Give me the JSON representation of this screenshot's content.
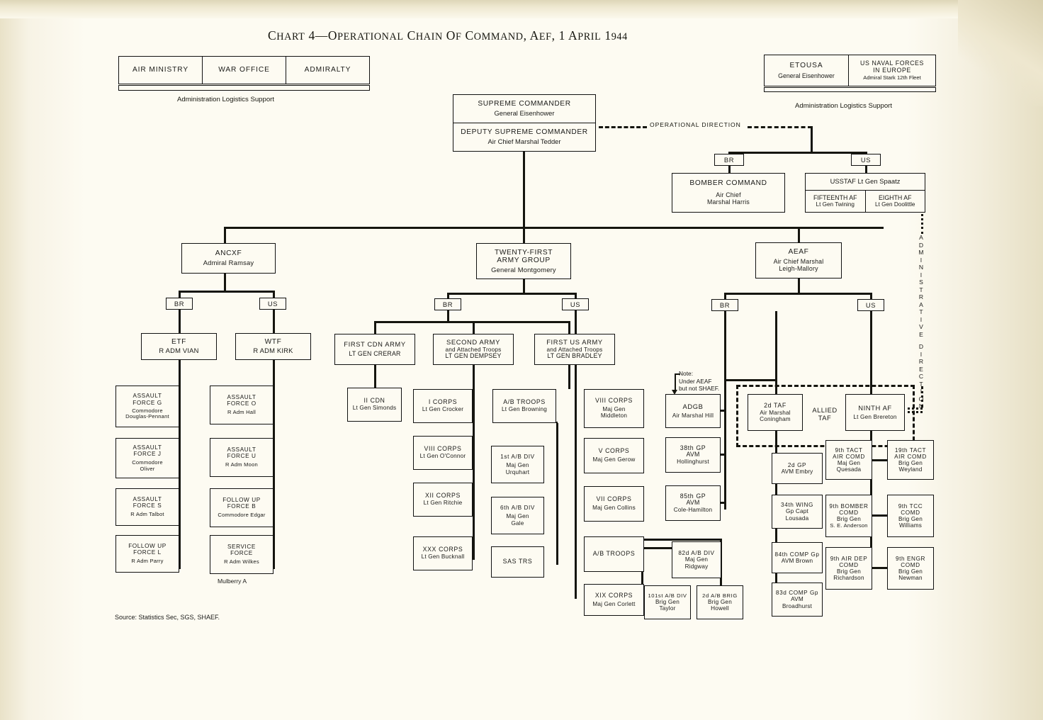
{
  "chart": {
    "title_prefix": "Chart 4",
    "title_dash": "—",
    "title_main": "Operational Chain of Command, AEF, 1 April 1944",
    "title_full": "Chart 4—Operational Chain of Command, AEF, 1 April 1944",
    "source_note": "Source: Statistics Sec, SGS, SHAEF.",
    "operational_direction_label": "OPERATIONAL DIRECTION",
    "administrative_direction_label": "ADMINISTRATIVE DIRECTION",
    "admin_left_caption": "Administration Logistics Support",
    "admin_right_caption": "Administration Logistics Support",
    "mulberry_caption": "Mulberry A",
    "aeaf_note": "Note:\nUnder AEAF\nbut not SHAEF.",
    "allied_taf_label_line1": "ALLIED",
    "allied_taf_label_line2": "TAF"
  },
  "tags": {
    "br": "BR",
    "us": "US"
  },
  "british_ministries": {
    "items": [
      {
        "label": "AIR MINISTRY"
      },
      {
        "label": "WAR OFFICE"
      },
      {
        "label": "ADMIRALTY"
      }
    ]
  },
  "us_theater": {
    "items": [
      {
        "title": "ETOUSA",
        "commander": "General  Eisenhower"
      },
      {
        "title_line1": "US NAVAL FORCES",
        "title_line2": "IN EUROPE",
        "commander": "Admiral Stark 12th Fleet"
      }
    ]
  },
  "supreme": {
    "commander_title": "SUPREME COMMANDER",
    "commander_name": "General  Eisenhower",
    "deputy_title": "DEPUTY SUPREME COMMANDER",
    "deputy_name": "Air Chief Marshal Tedder"
  },
  "strategic_air": {
    "bomber_command": {
      "title": "BOMBER COMMAND",
      "line1": "Air Chief",
      "line2": "Marshal Harris"
    },
    "usstaf": {
      "title": "USSTAF   Lt Gen Spaatz",
      "sub": [
        {
          "name": "FIFTEENTH AF",
          "commander": "Lt Gen Twining"
        },
        {
          "name": "EIGHTH AF",
          "commander": "Lt Gen Doolittle"
        }
      ]
    }
  },
  "ancxf": {
    "title": "ANCXF",
    "commander": "Admiral Ramsay",
    "br": {
      "force": {
        "title": "ETF",
        "commander": "R ADM VIAN"
      },
      "children": [
        {
          "line1": "ASSAULT",
          "line2": "FORCE G",
          "line3": "Commodore",
          "line4": "Douglas-Pennant"
        },
        {
          "line1": "ASSAULT",
          "line2": "FORCE J",
          "line3": "Commodore",
          "line4": "Oliver"
        },
        {
          "line1": "ASSAULT",
          "line2": "FORCE S",
          "line3": "R Adm Talbot"
        },
        {
          "line1": "FOLLOW UP",
          "line2": "FORCE L",
          "line3": "R Adm Parry"
        }
      ]
    },
    "us": {
      "force": {
        "title": "WTF",
        "commander": "R ADM KIRK"
      },
      "children": [
        {
          "line1": "ASSAULT",
          "line2": "FORCE O",
          "line3": "R Adm Hall"
        },
        {
          "line1": "ASSAULT",
          "line2": "FORCE U",
          "line3": "R Adm Moon"
        },
        {
          "line1": "FOLLOW UP",
          "line2": "FORCE B",
          "line3": "Commodore Edgar"
        },
        {
          "line1": "SERVICE",
          "line2": "FORCE",
          "line3": "R Adm Wilkes"
        }
      ]
    }
  },
  "army_group": {
    "title_line1": "TWENTY-FIRST",
    "title_line2": "ARMY GROUP",
    "commander": "General Montgomery",
    "br": {
      "first_cdn_army": {
        "title": "FIRST CDN ARMY",
        "commander": "LT GEN CRERAR",
        "children": [
          {
            "title": "II CDN",
            "commander": "Lt Gen Simonds"
          }
        ]
      },
      "second_army": {
        "title": "SECOND ARMY",
        "sub": "and Attached Troops",
        "commander": "LT GEN DEMPSEY",
        "children": [
          {
            "title": "I CORPS",
            "commander": "Lt Gen Crocker"
          },
          {
            "title": "VIII CORPS",
            "commander": "Lt Gen O'Connor"
          },
          {
            "title": "XII CORPS",
            "commander": "Lt Gen Ritchie"
          },
          {
            "title": "XXX CORPS",
            "commander": "Lt Gen Bucknall"
          }
        ],
        "ab_troops": {
          "title": "A/B TROOPS",
          "commander": "Lt Gen Browning",
          "children": [
            {
              "title": "1st  A/B DIV",
              "line2": "Maj Gen",
              "line3": "Urquhart"
            },
            {
              "title": "6th A/B DIV",
              "line2": "Maj Gen",
              "line3": "Gale"
            },
            {
              "title": "SAS TRS"
            }
          ]
        }
      }
    },
    "us": {
      "first_us_army": {
        "title": "FIRST US ARMY",
        "sub": "and Attached Troops",
        "commander": "LT GEN BRADLEY",
        "children": [
          {
            "title": "VIII CORPS",
            "line2": "Maj Gen",
            "line3": "Middleton"
          },
          {
            "title": "V CORPS",
            "line2": "Maj Gen Gerow"
          },
          {
            "title": "VII CORPS",
            "line2": "Maj Gen Collins"
          },
          {
            "title": "A/B TROOPS"
          },
          {
            "title": "XIX CORPS",
            "line2": "Maj Gen Corlett"
          }
        ],
        "ab_children": [
          {
            "title": "82d A/B DIV",
            "line2": "Maj Gen",
            "line3": "Ridgway"
          },
          {
            "title": "101st A/B DIV",
            "line2": "Brig Gen",
            "line3": "Taylor"
          },
          {
            "title": "2d A/B BRIG",
            "line2": "Brig Gen",
            "line3": "Howell"
          }
        ]
      }
    }
  },
  "aeaf": {
    "title": "AEAF",
    "commander_line1": "Air Chief Marshal",
    "commander_line2": "Leigh-Mallory",
    "adgb": {
      "title": "ADGB",
      "commander": "Air Marshal Hill"
    },
    "adgb_siblings": [
      {
        "title": "38th  GP",
        "line2": "AVM",
        "line3": "Hollinghurst"
      },
      {
        "title": "85th GP",
        "line2": "AVM",
        "line3": "Cole-Hamilton"
      }
    ],
    "second_taf": {
      "title": "2d  TAF",
      "line2": "Air Marshal",
      "line3": "Coningham"
    },
    "ninth_af": {
      "title": "NINTH AF",
      "commander": "Lt Gen Brereton"
    },
    "br_children": [
      {
        "title": "2d  GP",
        "line2": "AVM Embry"
      },
      {
        "title": "34th WING",
        "line2": "Gp Capt",
        "line3": "Lousada"
      },
      {
        "title": "84th COMP Gp",
        "line2": "AVM Brown"
      },
      {
        "title": "83d COMP Gp",
        "line2": "AVM",
        "line3": "Broadhurst"
      }
    ],
    "us_children_mid": [
      {
        "title": "9th TACT",
        "line2": "AIR COMD",
        "line3": "Maj Gen",
        "line4": "Quesada"
      },
      {
        "title": "9th BOMBER",
        "line2": "COMD",
        "line3": "Brig Gen",
        "line4": "S. E. Anderson"
      },
      {
        "title": "9th AIR DEP",
        "line2": "COMD",
        "line3": "Brig Gen",
        "line4": "Richardson"
      }
    ],
    "us_children_right": [
      {
        "title": "19th TACT",
        "line2": "AIR COMD",
        "line3": "Brig Gen",
        "line4": "Weyland"
      },
      {
        "title": "9th TCC",
        "line2": "COMD",
        "line3": "Brig Gen",
        "line4": "Williams"
      },
      {
        "title": "9th ENGR",
        "line2": "COMD",
        "line3": "Brig Gen",
        "line4": "Newman"
      }
    ]
  },
  "colors": {
    "ink": "#15150f",
    "paper": "#fbf8ec",
    "box_fill": "#fdfbf2"
  }
}
